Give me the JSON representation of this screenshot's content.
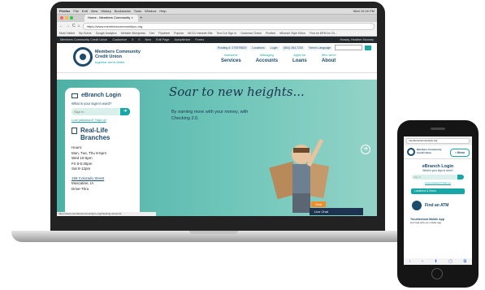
{
  "mac_menu": {
    "apple": "",
    "items": [
      "Firefox",
      "File",
      "Edit",
      "View",
      "History",
      "Bookmarks",
      "Tools",
      "Window",
      "Help"
    ],
    "clock": "Wed 10:16 PM"
  },
  "browser": {
    "tab_title": "Home - Members Community",
    "tab_close": "×",
    "new_tab": "+",
    "url": "https://www.memberscommunitycu.org",
    "nav": {
      "back": "←",
      "forward": "→",
      "reload": "C",
      "home": "⌂"
    },
    "bookmarks": [
      "Most Visited",
      "My Scene",
      "Google Analytics",
      "Website Wordpress",
      "Dev",
      "Flywheel",
      "Popular",
      "MCCU Intranet Site",
      "Text Cut Sign In",
      "Grammar Check",
      "Pixelied",
      "eBranch Style Editor",
      "Find an MFM for Ch..."
    ]
  },
  "wp_admin": {
    "items": [
      "Members Community Credit Union",
      "Customize",
      "0",
      "0",
      "New",
      "Edit Page",
      "Autoptimize",
      "Forms"
    ],
    "howdy": "Howdy, Heather Mooney"
  },
  "site": {
    "logo_line1": "Members Community",
    "logo_line2": "Credit Union",
    "tagline": "together we're better",
    "routing": "Routing #: 273975629",
    "utility": [
      "Locations",
      "Login",
      "(563) 264-7230"
    ],
    "language": "Select Language",
    "search_placeholder": "Search...",
    "nav": [
      {
        "small": "Awesome",
        "big": "Services"
      },
      {
        "small": "Managing",
        "big": "Accounts"
      },
      {
        "small": "Apply for",
        "big": "Loans"
      },
      {
        "small": "Who we're",
        "big": "About"
      }
    ]
  },
  "hero": {
    "headline": "Soar to new heights...",
    "subtitle": "By earning more with your money, with Checking 2.0.",
    "arrow": "➜",
    "chat_badge": "Chat",
    "chat": "Live Chat"
  },
  "ebranch": {
    "title": "eBranch Login",
    "question": "What is your sign-in word?",
    "input_placeholder": "Sign In",
    "go": "➜",
    "links": "Lost password? Sign up",
    "locations_title": "Real-Life Branches",
    "hours_label": "Hours:",
    "hours": [
      "Mon, Tue, Thu 9-5pm",
      "Wed 10-5pm",
      "Fri 8-5:30pm",
      "Sat 8-12pm"
    ],
    "address_link": "159 Colorado Street",
    "address_city": "Muscatine, IA",
    "drive_thru": "Drive-Thru"
  },
  "statusbar": "https://www.memberscommunitycu.org/checking-accounts",
  "phone": {
    "url": "memberscommunitycu.org",
    "logo": "Members Community Credit Union",
    "menu": "≡ Menu",
    "ebranch_title": "eBranch Login",
    "ebranch_question": "What is your sign-in word?",
    "input_placeholder": "Sign In",
    "links": "Lost password? Sign up",
    "hours_bar": "Locations & Hours",
    "atm": "Find an ATM",
    "trouble_title": "Troubleshoot Mobile App",
    "trouble_sub": "Get help with our mobile app",
    "nav": [
      "‹",
      "›",
      "⬆",
      "▢",
      "⧉"
    ]
  }
}
